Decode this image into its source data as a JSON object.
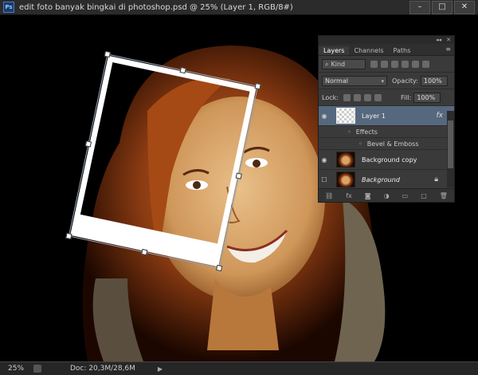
{
  "window": {
    "app_icon": "Ps",
    "title": "edit foto banyak bingkai di photoshop.psd @ 25% (Layer 1, RGB/8#)",
    "buttons": [
      "minimize",
      "maximize",
      "close"
    ]
  },
  "status": {
    "zoom": "25%",
    "doc_info": "Doc: 20,3M/28,6M"
  },
  "layers_panel": {
    "tabs": [
      "Layers",
      "Channels",
      "Paths"
    ],
    "active_tab": "Layers",
    "filter_kind": "Kind",
    "blend_mode": "Normal",
    "opacity_label": "Opacity:",
    "opacity_value": "100%",
    "lock_label": "Lock:",
    "fill_label": "Fill:",
    "fill_value": "100%",
    "layers": [
      {
        "name": "Layer 1",
        "fx": "fx",
        "selected": true,
        "thumb": "transparent"
      },
      {
        "name": "Background copy",
        "selected": false,
        "thumb": "photo"
      },
      {
        "name": "Background",
        "selected": false,
        "thumb": "photo",
        "locked": true
      }
    ],
    "effects_label": "Effects",
    "effect_item": "Bevel & Emboss"
  },
  "colors": {
    "hair": "#8a3b12",
    "skin": "#d9a46a",
    "panel_bg": "#3a3a3a",
    "selected_layer": "#56687e"
  }
}
